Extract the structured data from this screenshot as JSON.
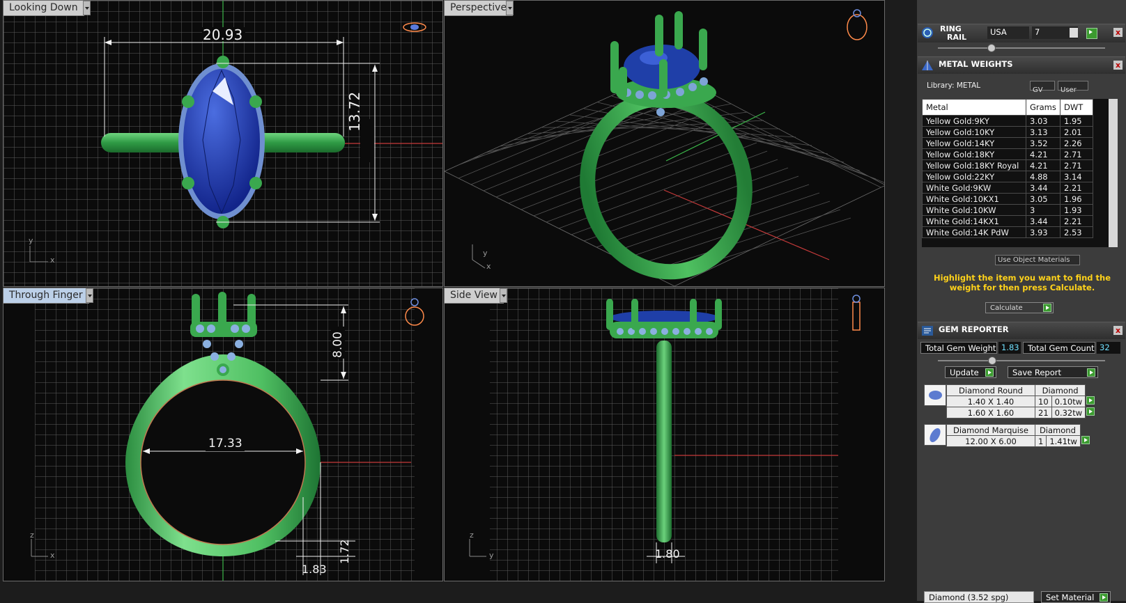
{
  "viewports": {
    "top_left": {
      "label": "Looking Down",
      "dims": [
        "20.93",
        "13.72"
      ],
      "axes": [
        "y",
        "x"
      ]
    },
    "top_right": {
      "label": "Perspective",
      "axes": [
        "y",
        "x"
      ]
    },
    "bottom_left": {
      "label": "Through Finger",
      "dims": [
        "8.00",
        "17.33",
        "1.72",
        "1.83"
      ],
      "axes": [
        "z",
        "x"
      ]
    },
    "bottom_right": {
      "label": "Side View",
      "dims": [
        "1.80"
      ],
      "axes": [
        "z",
        "y"
      ]
    }
  },
  "ring_rail": {
    "title_line1": "RING",
    "title_line2": "RAIL",
    "country": "USA",
    "size": "7"
  },
  "metal_weights": {
    "title": "METAL WEIGHTS",
    "library_label": "Library: METAL",
    "gv_label": "GV",
    "user_label": "User",
    "columns": [
      "Metal",
      "Grams",
      "DWT"
    ],
    "rows": [
      [
        "Yellow Gold:9KY",
        "3.03",
        "1.95"
      ],
      [
        "Yellow Gold:10KY",
        "3.13",
        "2.01"
      ],
      [
        "Yellow Gold:14KY",
        "3.52",
        "2.26"
      ],
      [
        "Yellow Gold:18KY",
        "4.21",
        "2.71"
      ],
      [
        "Yellow Gold:18KY Royal",
        "4.21",
        "2.71"
      ],
      [
        "Yellow Gold:22KY",
        "4.88",
        "3.14"
      ],
      [
        "White Gold:9KW",
        "3.44",
        "2.21"
      ],
      [
        "White Gold:10KX1",
        "3.05",
        "1.96"
      ],
      [
        "White Gold:10KW",
        "3",
        "1.93"
      ],
      [
        "White Gold:14KX1",
        "3.44",
        "2.21"
      ],
      [
        "White Gold:14K PdW",
        "3.93",
        "2.53"
      ]
    ],
    "use_object_materials": "Use Object Materials",
    "hint": "Highlight the item you want to find the weight for then press Calculate.",
    "calculate_label": "Calculate"
  },
  "gem_reporter": {
    "title": "GEM REPORTER",
    "total_weight_label": "Total Gem Weight",
    "total_weight": "1.83",
    "total_count_label": "Total Gem Count",
    "total_count": "32",
    "update_label": "Update",
    "save_label": "Save Report",
    "groups": [
      {
        "name": "Diamond Round",
        "material": "Diamond",
        "rows": [
          {
            "size": "1.40 X 1.40",
            "count": "10",
            "weight": "0.10tw"
          },
          {
            "size": "1.60 X 1.60",
            "count": "21",
            "weight": "0.32tw"
          }
        ]
      },
      {
        "name": "Diamond Marquise",
        "material": "Diamond",
        "rows": [
          {
            "size": "12.00 X 6.00",
            "count": "1",
            "weight": "1.41tw"
          }
        ]
      }
    ],
    "material_select": "Diamond    (3.52 spg)",
    "set_material_label": "Set Material"
  },
  "colors": {
    "ring_green": "#3aa84e",
    "gem_blue": "#1f3fa8",
    "accent_gold": "#ffd21a",
    "grid_line": "#5a5a5a"
  }
}
